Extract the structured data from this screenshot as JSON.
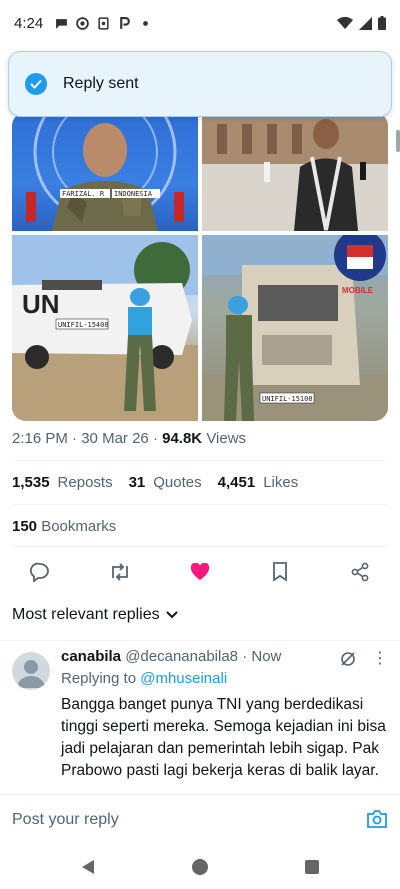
{
  "status_bar": {
    "time": "4:24",
    "left_icons": [
      "chat-icon",
      "messenger-icon",
      "sim-icon",
      "parking-icon",
      "dot-icon"
    ],
    "right_icons": [
      "wifi-icon",
      "signal-icon",
      "battery-icon"
    ]
  },
  "toast": {
    "label": "Reply sent",
    "icon": "check-circle-icon"
  },
  "media": {
    "tiles": [
      {
        "name": "photo-soldier-un-flag",
        "patch_left": "FARIZAL. R",
        "patch_right": "INDONESIA"
      },
      {
        "name": "photo-man-courtyard"
      },
      {
        "name": "photo-soldier-apc",
        "vehicle_text": "UN",
        "plate": "UNIFIL-15400"
      },
      {
        "name": "photo-soldier-armored-truck",
        "plate": "UNIFIL-15108",
        "badge": "MOBILE"
      }
    ]
  },
  "tweet_meta": {
    "time": "2:16 PM",
    "separator": "·",
    "date": "30 Mar 26",
    "views_count": "94.8K",
    "views_label": "Views"
  },
  "stats": {
    "reposts_count": "1,535",
    "reposts_label": "Reposts",
    "quotes_count": "31",
    "quotes_label": "Quotes",
    "likes_count": "4,451",
    "likes_label": "Likes",
    "bookmarks_count": "150",
    "bookmarks_label": "Bookmarks"
  },
  "actions": [
    "reply-icon",
    "repost-icon",
    "like-icon",
    "bookmark-icon",
    "share-icon"
  ],
  "colors": {
    "accent": "#1d9bf0",
    "like": "#f91880",
    "muted": "#536471",
    "text": "#0f1419"
  },
  "sort": {
    "label": "Most relevant replies"
  },
  "reply": {
    "display_name": "canabila",
    "handle": "@decananabila8",
    "time": "· Now",
    "replying_to_prefix": "Replying to",
    "replying_to_handle": "@mhuseinali",
    "text": "Bangga banget punya TNI yang berdedikasi tinggi seperti mereka. Semoga kejadian ini bisa jadi pelajaran dan pemerintah lebih sigap. Pak Prabowo pasti lagi bekerja keras di balik layar."
  },
  "composer": {
    "placeholder": "Post your reply"
  },
  "nav": [
    "back-icon",
    "home-icon",
    "recents-icon"
  ]
}
